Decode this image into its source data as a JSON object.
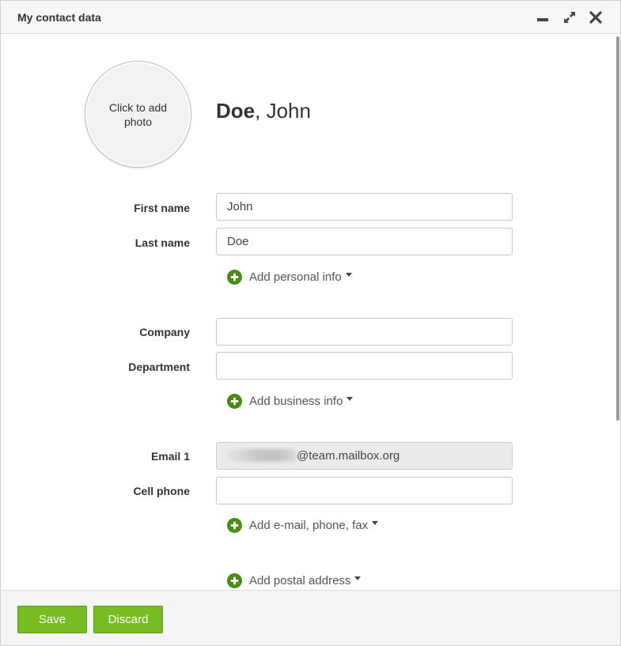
{
  "window": {
    "title": "My contact data"
  },
  "photo": {
    "label": "Click to add photo"
  },
  "header": {
    "last_name": "Doe",
    "separator": ", ",
    "first_name": "John"
  },
  "fields": {
    "first_name": {
      "label": "First name",
      "value": "John"
    },
    "last_name": {
      "label": "Last name",
      "value": "Doe"
    },
    "company": {
      "label": "Company",
      "value": ""
    },
    "department": {
      "label": "Department",
      "value": ""
    },
    "email1": {
      "label": "Email 1",
      "value": "@team.mailbox.org"
    },
    "cell_phone": {
      "label": "Cell phone",
      "value": ""
    }
  },
  "add_links": {
    "personal": "Add personal info",
    "business": "Add business info",
    "email_phone_fax": "Add e-mail, phone, fax",
    "postal": "Add postal address"
  },
  "footer": {
    "save_label": "Save",
    "discard_label": "Discard"
  },
  "colors": {
    "accent_green": "#77bd21",
    "icon_green": "#4c8a16"
  }
}
